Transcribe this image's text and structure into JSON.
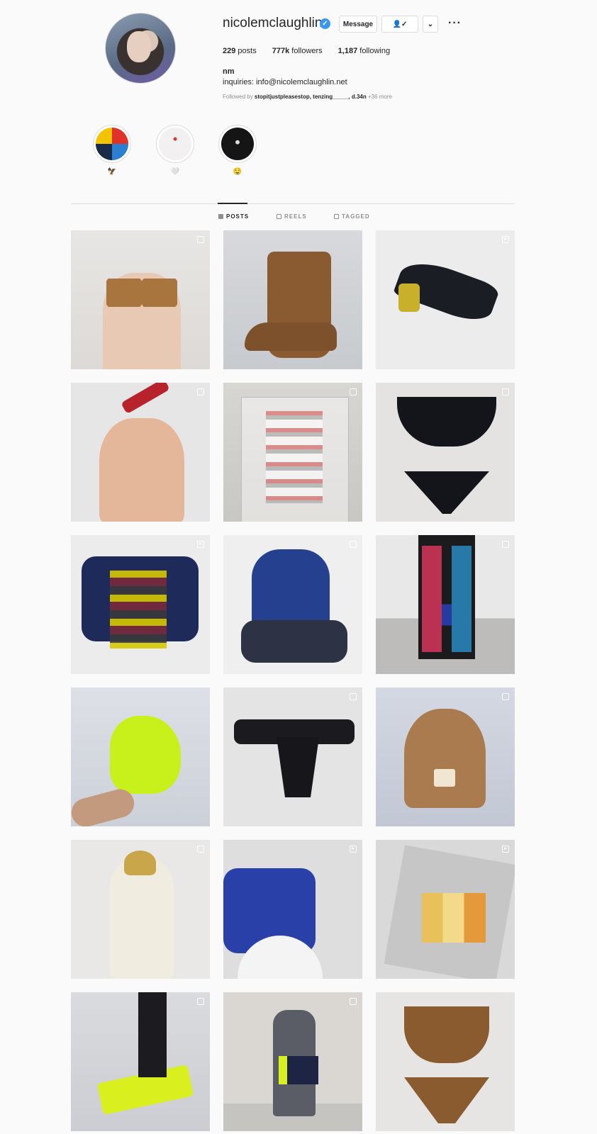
{
  "profile": {
    "username": "nicolemclaughlin",
    "verified_icon": "verified-badge-icon",
    "message_label": "Message",
    "follow_icon": "person-check-icon",
    "dropdown_icon": "chevron-down-icon",
    "more_icon": "more-options-icon",
    "more_glyph": "···",
    "stats": {
      "posts_count": "229",
      "posts_label": "posts",
      "followers_count": "777k",
      "followers_label": "followers",
      "following_count": "1,187",
      "following_label": "following"
    },
    "full_name": "nm",
    "bio": "inquiries: info@nicolemclaughlin.net",
    "followed_by_prefix": "Followed by",
    "followed_by_names": "stopitjustpleasestop, tenzing_____, d.34n",
    "followed_by_more": "+36 more"
  },
  "highlights": [
    {
      "label": "🦅",
      "icon": "highlight-cover-1"
    },
    {
      "label": "🤍",
      "icon": "highlight-cover-2"
    },
    {
      "label": "🤤",
      "icon": "highlight-cover-3"
    }
  ],
  "tabs": [
    {
      "label": "POSTS",
      "icon": "grid-icon",
      "active": true
    },
    {
      "label": "REELS",
      "icon": "reels-icon",
      "active": false
    },
    {
      "label": "TAGGED",
      "icon": "tagged-icon",
      "active": false
    }
  ],
  "posts": [
    {
      "badge": "carousel"
    },
    {
      "badge": "none"
    },
    {
      "badge": "reel"
    },
    {
      "badge": "carousel"
    },
    {
      "badge": "carousel"
    },
    {
      "badge": "carousel"
    },
    {
      "badge": "reel"
    },
    {
      "badge": "carousel"
    },
    {
      "badge": "carousel"
    },
    {
      "badge": "none"
    },
    {
      "badge": "carousel"
    },
    {
      "badge": "carousel"
    },
    {
      "badge": "carousel"
    },
    {
      "badge": "reel"
    },
    {
      "badge": "reel"
    },
    {
      "badge": "carousel"
    },
    {
      "badge": "carousel"
    },
    {
      "badge": "none"
    }
  ],
  "colors": {
    "background": "#fafafa",
    "text": "#262626",
    "muted": "#8e8e8e",
    "border": "#dbdbdb",
    "verified": "#3897f0"
  }
}
